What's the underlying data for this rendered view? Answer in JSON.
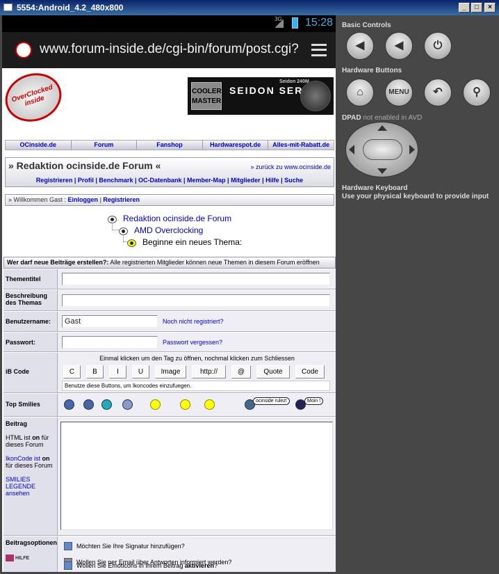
{
  "window": {
    "title": "5554:Android_4.2_480x800",
    "min": "_",
    "max": "□",
    "close": "×"
  },
  "status": {
    "network": "3G",
    "time": "15:28"
  },
  "browser": {
    "url": "www.forum-inside.de/cgi-bin/forum/post.cgi?"
  },
  "logo_text": "OverClocked inside",
  "banner": {
    "brand": "COOLER MASTER",
    "product": "SEIDON SERIES",
    "model": "Seidon 240M"
  },
  "nav": [
    "OCinside.de",
    "Forum",
    "Fanshop",
    "Hardwarespot.de",
    "Alles-mit-Rabatt.de"
  ],
  "forum": {
    "title": "» Redaktion ocinside.de Forum «",
    "back_link": "» zurück zu www.ocinside.de",
    "links": [
      "Registrieren",
      "Profil",
      "Benchmark",
      "OC-Datenbank",
      "Member-Map",
      "Mitglieder",
      "Hilfe",
      "Suche"
    ]
  },
  "welcome": {
    "prefix": "» Willkommen Gast :",
    "login": "Einloggen",
    "sep": "|",
    "register": "Registrieren"
  },
  "tree": [
    "Redaktion ocinside.de Forum",
    "AMD Overclocking",
    "Beginne ein neues Thema:"
  ],
  "permissions": {
    "label": "Wer darf neue Beiträge erstellen?:",
    "text": "Alle registrierten Mitglieder können neue Themen in diesem Forum eröffnen"
  },
  "fields": {
    "thementitel": "Thementitel",
    "beschreibung": "Beschreibung des Themas",
    "benutzername": "Benutzername:",
    "benutzername_value": "Gast",
    "not_registered": "Noch nicht registriert?",
    "passwort": "Passwort:",
    "forgot": "Passwort vergessen?"
  },
  "ibcode": {
    "label": "iB Code",
    "hint": "Einmal klicken um den Tag zu öffnen, nochmal klicken zum Schliessen",
    "buttons": [
      "C",
      "B",
      "I",
      "U",
      "Image",
      "http://",
      "@",
      "Quote",
      "Code"
    ],
    "help": "Benutze diese Buttons, um Ikoncodes einzufuegen."
  },
  "smilies": {
    "label": "Top Smilies",
    "badge1": "ocinside rulez!",
    "badge2": "Moin !"
  },
  "beitrag": {
    "label": "Beitrag",
    "html_prefix": "HTML ist",
    "html_state": "on",
    "html_suffix": "für dieses Forum",
    "ikon_link": "IkonCode ist",
    "ikon_state": "on",
    "ikon_suffix": "für dieses Forum",
    "legend": "SMILIES LEGENDE ansehen"
  },
  "options": {
    "label": "Beitragsoptionen",
    "hilfe": "HILFE",
    "opt1": "Möchten Sie Ihre Signatur hinzufügen?",
    "opt2": "Wollen Sie per Email über Antworten informiert werden?",
    "opt3_pre": "Wollen Sie Emoticons in Ihrem Beitrag",
    "opt3_bold": "aktivieren",
    "opt3_post": "?"
  },
  "emulator": {
    "basic_controls": "Basic Controls",
    "hardware_buttons": "Hardware Buttons",
    "menu": "MENU",
    "dpad_label": "DPAD",
    "dpad_status": "not enabled in AVD",
    "keyboard_title": "Hardware Keyboard",
    "keyboard_text": "Use your physical keyboard to provide input"
  }
}
